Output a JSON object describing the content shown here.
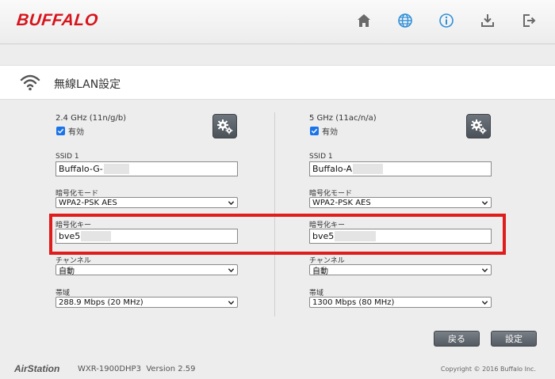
{
  "header": {
    "logo": "BUFFALO",
    "nav": [
      {
        "icon": "home-icon"
      },
      {
        "icon": "globe-icon",
        "active": true
      },
      {
        "icon": "info-icon",
        "active": true
      },
      {
        "icon": "download-icon"
      },
      {
        "icon": "logout-icon"
      }
    ]
  },
  "section": {
    "title": "無線LAN設定",
    "icon": "wifi-icon"
  },
  "bands": [
    {
      "title": "2.4 GHz (11n/g/b)",
      "enabled_label": "有効",
      "enabled": true,
      "ssid_label": "SSID 1",
      "ssid_value": "Buffalo-G-",
      "encryption_mode_label": "暗号化モード",
      "encryption_mode_value": "WPA2-PSK AES",
      "encryption_key_label": "暗号化キー",
      "encryption_key_value": "bve5",
      "channel_label": "チャンネル",
      "channel_value": "自動",
      "bandwidth_label": "帯域",
      "bandwidth_value": "288.9 Mbps (20 MHz)"
    },
    {
      "title": "5 GHz (11ac/n/a)",
      "enabled_label": "有効",
      "enabled": true,
      "ssid_label": "SSID 1",
      "ssid_value": "Buffalo-A",
      "encryption_mode_label": "暗号化モード",
      "encryption_mode_value": "WPA2-PSK AES",
      "encryption_key_label": "暗号化キー",
      "encryption_key_value": "bve5",
      "channel_label": "チャンネル",
      "channel_value": "自動",
      "bandwidth_label": "帯域",
      "bandwidth_value": "1300 Mbps (80 MHz)"
    }
  ],
  "buttons": {
    "back": "戻る",
    "apply": "設定"
  },
  "footer": {
    "brand": "AirStation",
    "model": "WXR-1900DHP3",
    "version": "Version 2.59",
    "copyright": "Copyright © 2016 Buffalo Inc."
  },
  "colors": {
    "brand_red": "#d7141c",
    "highlight_red": "#e01d1d",
    "button_gray": "#5f656c",
    "accent_blue": "#1a73e8"
  }
}
